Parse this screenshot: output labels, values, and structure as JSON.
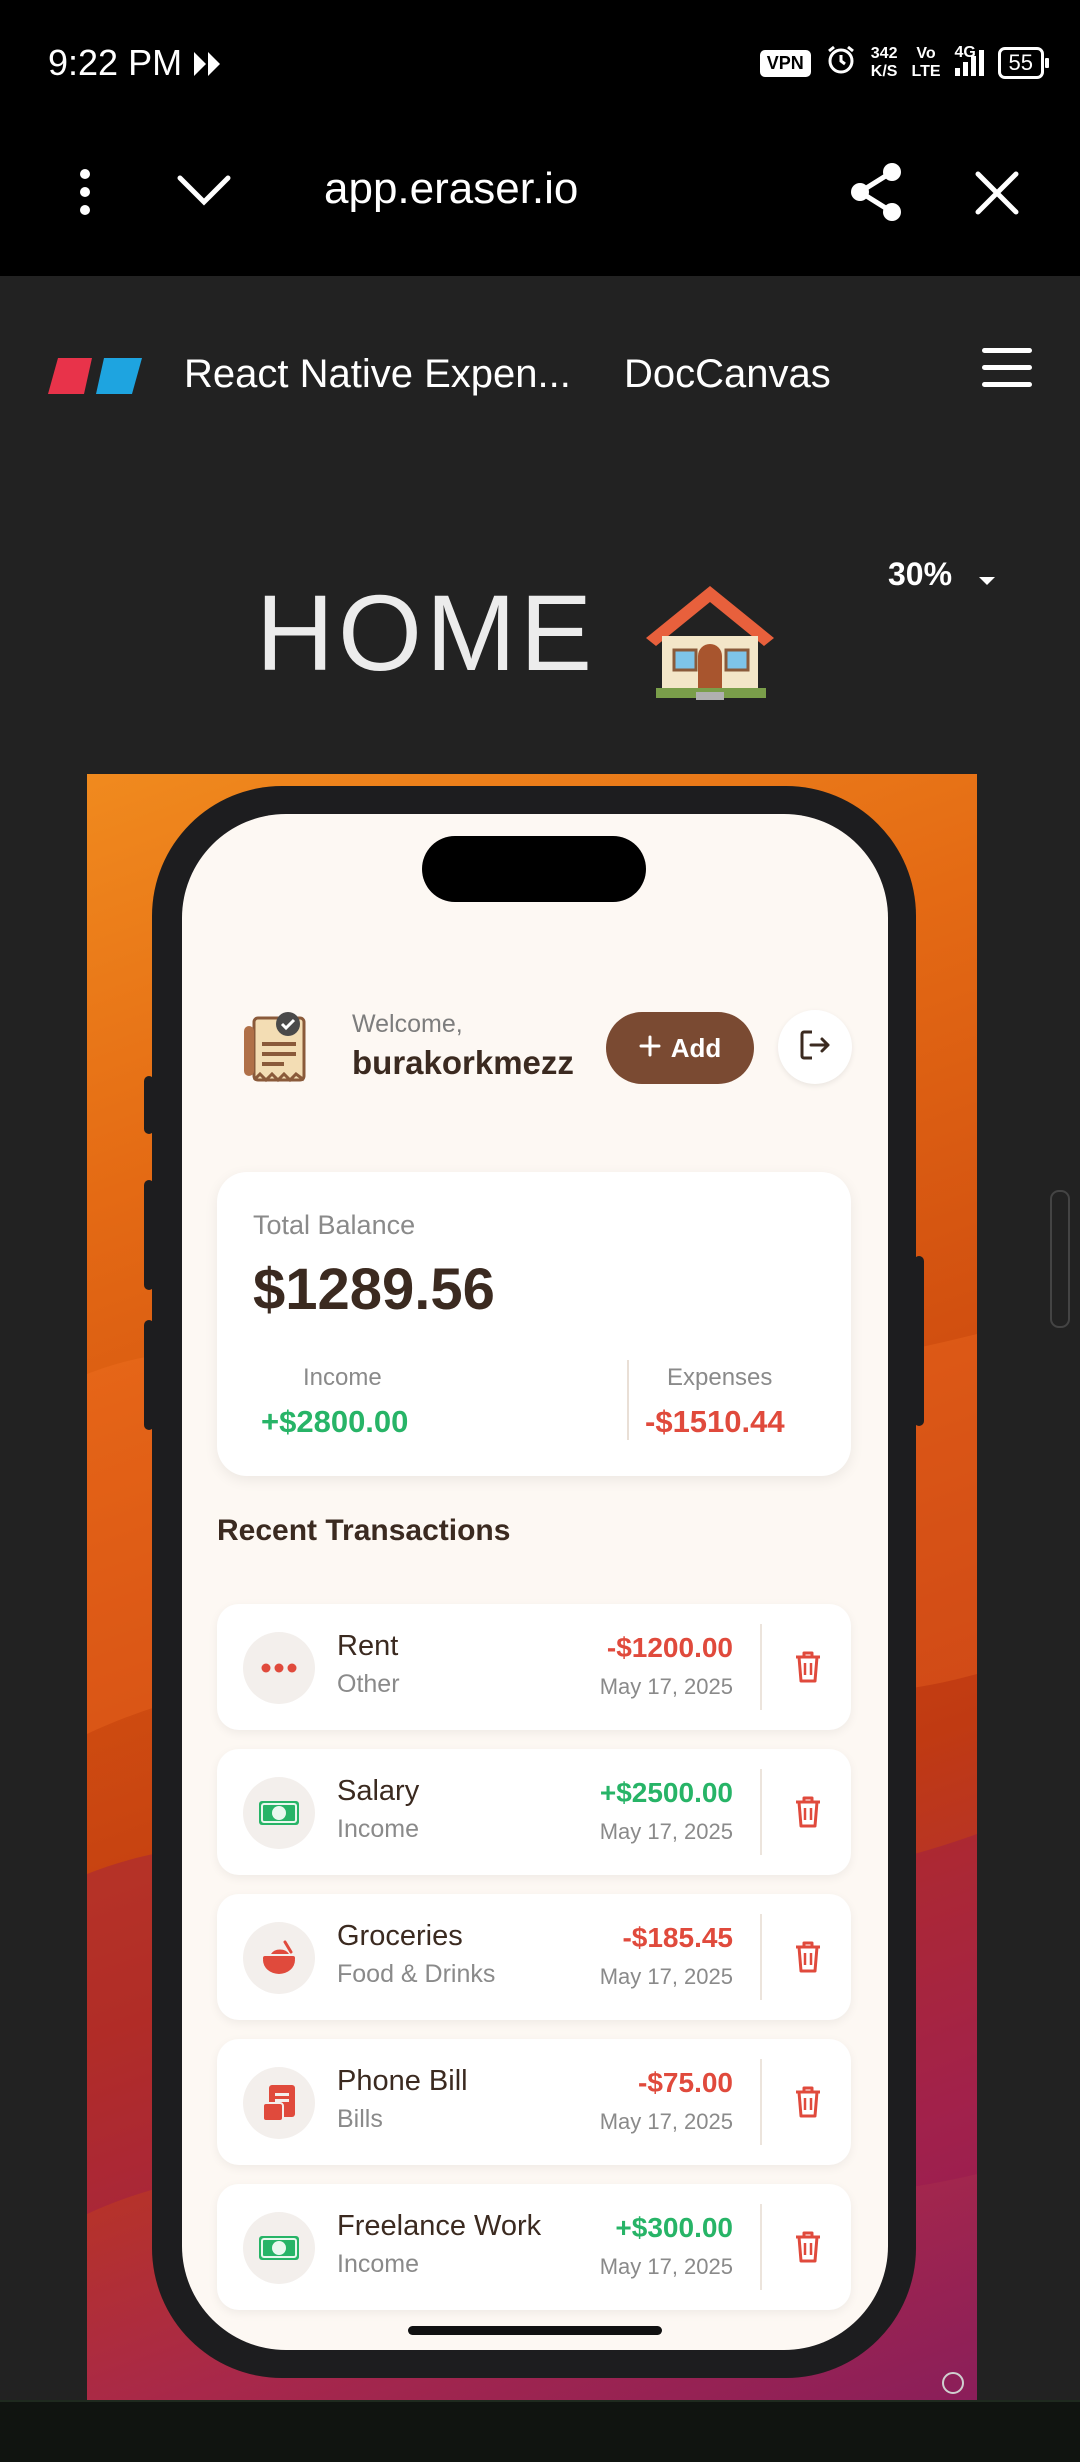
{
  "status_bar": {
    "time": "9:22 PM",
    "vpn": "VPN",
    "net_speed_value": "342",
    "net_speed_unit": "K/S",
    "volte_top": "Vo",
    "volte_bottom": "LTE",
    "network": "4G",
    "battery": "55"
  },
  "browser": {
    "url": "app.eraser.io"
  },
  "app_header": {
    "doc_title": "React Native Expen...",
    "doccanvas_label": "DocCanvas"
  },
  "canvas": {
    "heading": "HOME",
    "heading_emoji": "🏠",
    "zoom_label": "30%"
  },
  "phone_app": {
    "welcome": "Welcome,",
    "username": "burakorkmezz",
    "add_button_label": "Add",
    "balance": {
      "label": "Total Balance",
      "amount": "$1289.56",
      "income_label": "Income",
      "income_value": "+$2800.00",
      "expenses_label": "Expenses",
      "expenses_value": "-$1510.44"
    },
    "recent_title": "Recent Transactions",
    "transactions": [
      {
        "name": "Rent",
        "category": "Other",
        "amount": "-$1200.00",
        "date": "May 17, 2025",
        "icon": "more-dots-icon",
        "sign": "neg"
      },
      {
        "name": "Salary",
        "category": "Income",
        "amount": "+$2500.00",
        "date": "May 17, 2025",
        "icon": "cash-icon",
        "sign": "pos"
      },
      {
        "name": "Groceries",
        "category": "Food & Drinks",
        "amount": "-$185.45",
        "date": "May 17, 2025",
        "icon": "food-icon",
        "sign": "neg"
      },
      {
        "name": "Phone Bill",
        "category": "Bills",
        "amount": "-$75.00",
        "date": "May 17, 2025",
        "icon": "bill-icon",
        "sign": "neg"
      },
      {
        "name": "Freelance Work",
        "category": "Income",
        "amount": "+$300.00",
        "date": "May 17, 2025",
        "icon": "cash-icon",
        "sign": "pos"
      }
    ]
  },
  "colors": {
    "accent_brown": "#7a4a32",
    "income_green": "#27b467",
    "expense_red": "#e04a3c",
    "screen_bg": "#fdf8f3"
  }
}
